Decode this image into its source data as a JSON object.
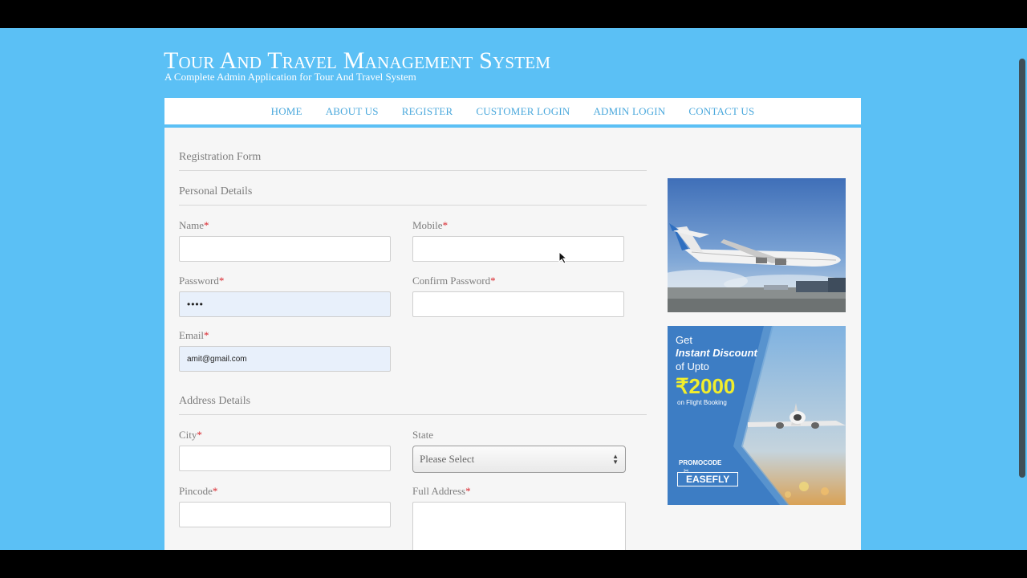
{
  "header": {
    "title": "Tour And Travel Management System",
    "tagline": "A Complete Admin Application for Tour And Travel System"
  },
  "nav": [
    {
      "label": "HOME"
    },
    {
      "label": "ABOUT US"
    },
    {
      "label": "REGISTER"
    },
    {
      "label": "CUSTOMER LOGIN"
    },
    {
      "label": "ADMIN LOGIN"
    },
    {
      "label": "CONTACT US"
    }
  ],
  "form": {
    "title": "Registration Form",
    "required_mark": "*",
    "personal": {
      "heading": "Personal Details",
      "name_label": "Name",
      "name_value": "",
      "mobile_label": "Mobile",
      "mobile_value": "",
      "password_label": "Password",
      "password_value": "••••",
      "confirm_label": "Confirm Password",
      "confirm_value": "",
      "email_label": "Email",
      "email_value": "amit@gmail.com"
    },
    "address": {
      "heading": "Address Details",
      "city_label": "City",
      "city_value": "",
      "state_label": "State",
      "state_selected": "Please Select",
      "pincode_label": "Pincode",
      "pincode_value": "",
      "full_address_label": "Full Address"
    }
  },
  "promo": {
    "line1": "Get",
    "line2": "Instant Discount",
    "line3": "of Upto",
    "amount": "₹2000",
    "sub": "on Flight Booking",
    "code_label": "PROMOCODE",
    "code": "EASEFLY"
  },
  "colors": {
    "page_bg": "#5bc0f5",
    "nav_link": "#4aa8dc",
    "required": "#d9262d",
    "filled_input": "#e8f0fb",
    "promo_yellow": "#f1ee2d"
  }
}
